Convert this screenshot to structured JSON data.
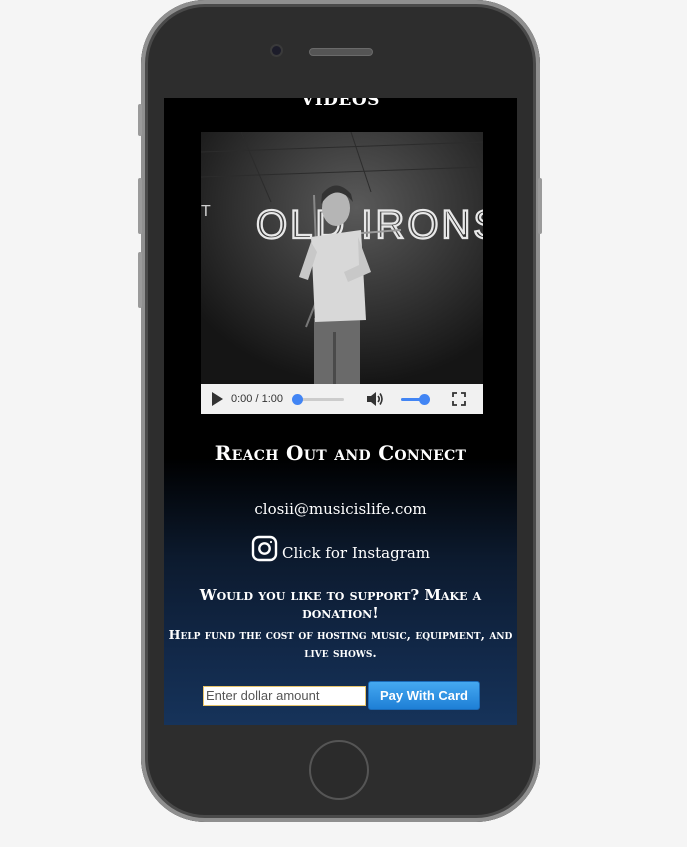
{
  "section_title": "VIDEOS",
  "video": {
    "time": "0:00 / 1:00",
    "progress": 0.0,
    "volume": 1.0,
    "neon_sign": "OLD IRONS"
  },
  "connect": {
    "heading": "Reach Out and Connect",
    "email": "closii@musicislife.com",
    "instagram_label": "Click for Instagram"
  },
  "donation": {
    "heading": "Would you like to support? Make a donation!",
    "help_text": "Help fund the cost of hosting music, equipment, and live shows.",
    "input_placeholder": "Enter dollar amount",
    "pay_button_label": "Pay With Card"
  },
  "colors": {
    "accent": "#1e7fd6",
    "media_accent": "#4285f4",
    "background_bottom": "#16335a"
  }
}
